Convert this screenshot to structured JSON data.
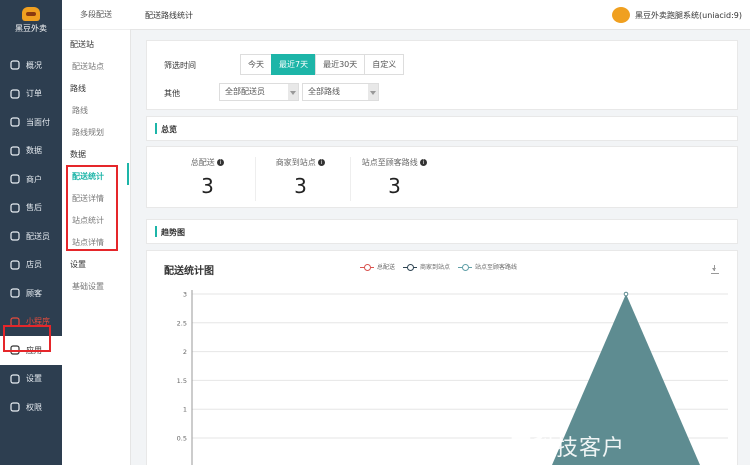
{
  "brand": {
    "name": "黑豆外卖"
  },
  "nav": [
    {
      "label": "概况",
      "icon": "dashboard-icon"
    },
    {
      "label": "订单",
      "icon": "order-icon"
    },
    {
      "label": "当面付",
      "icon": "pay-icon"
    },
    {
      "label": "数据",
      "icon": "data-icon"
    },
    {
      "label": "商户",
      "icon": "store-icon"
    },
    {
      "label": "售后",
      "icon": "aftersale-icon"
    },
    {
      "label": "配送员",
      "icon": "courier-icon"
    },
    {
      "label": "店员",
      "icon": "clerk-icon"
    },
    {
      "label": "顾客",
      "icon": "customer-icon"
    },
    {
      "label": "小程序",
      "icon": "miniapp-icon"
    },
    {
      "label": "应用",
      "icon": "apps-icon"
    },
    {
      "label": "设置",
      "icon": "settings-icon"
    },
    {
      "label": "权限",
      "icon": "lock-icon"
    }
  ],
  "sub": {
    "header": "多段配送",
    "groups": [
      {
        "title": "配送站",
        "items": [
          "配送站点"
        ]
      },
      {
        "title": "路线",
        "items": [
          "路线",
          "路线规划"
        ]
      },
      {
        "title": "数据",
        "items": [
          "配送统计",
          "配送详情",
          "站点统计",
          "站点详情"
        ]
      },
      {
        "title": "设置",
        "items": [
          "基础设置"
        ]
      }
    ]
  },
  "top": {
    "title": "配送路线统计",
    "account": "黑豆外卖跑腿系统(uniacid:9)"
  },
  "filter": {
    "time_label": "筛选时间",
    "time_options": [
      "今天",
      "最近7天",
      "最近30天",
      "自定义"
    ],
    "selected": "最近7天",
    "other_label": "其他",
    "courier_select": "全部配送员",
    "route_select": "全部路线"
  },
  "overview": {
    "title": "总览",
    "stats": [
      {
        "label": "总配送",
        "value": "3"
      },
      {
        "label": "商家到站点",
        "value": "3"
      },
      {
        "label": "站点至顾客路线",
        "value": "3"
      }
    ]
  },
  "trend": {
    "title": "趋势图"
  },
  "chart_data": {
    "type": "area",
    "title": "配送统计图",
    "series": [
      {
        "name": "总配送",
        "color": "#d9534f"
      },
      {
        "name": "商家到站点",
        "color": "#2f4554"
      },
      {
        "name": "站点至顾客路线",
        "color": "#61a0a8"
      }
    ],
    "yticks": [
      "0.5",
      "1",
      "1.5",
      "2",
      "2.5",
      "3"
    ],
    "ylim": [
      0,
      3
    ],
    "peak_value": 3,
    "fill_color": "#5e8c91"
  },
  "watermark": "豆科技客户"
}
